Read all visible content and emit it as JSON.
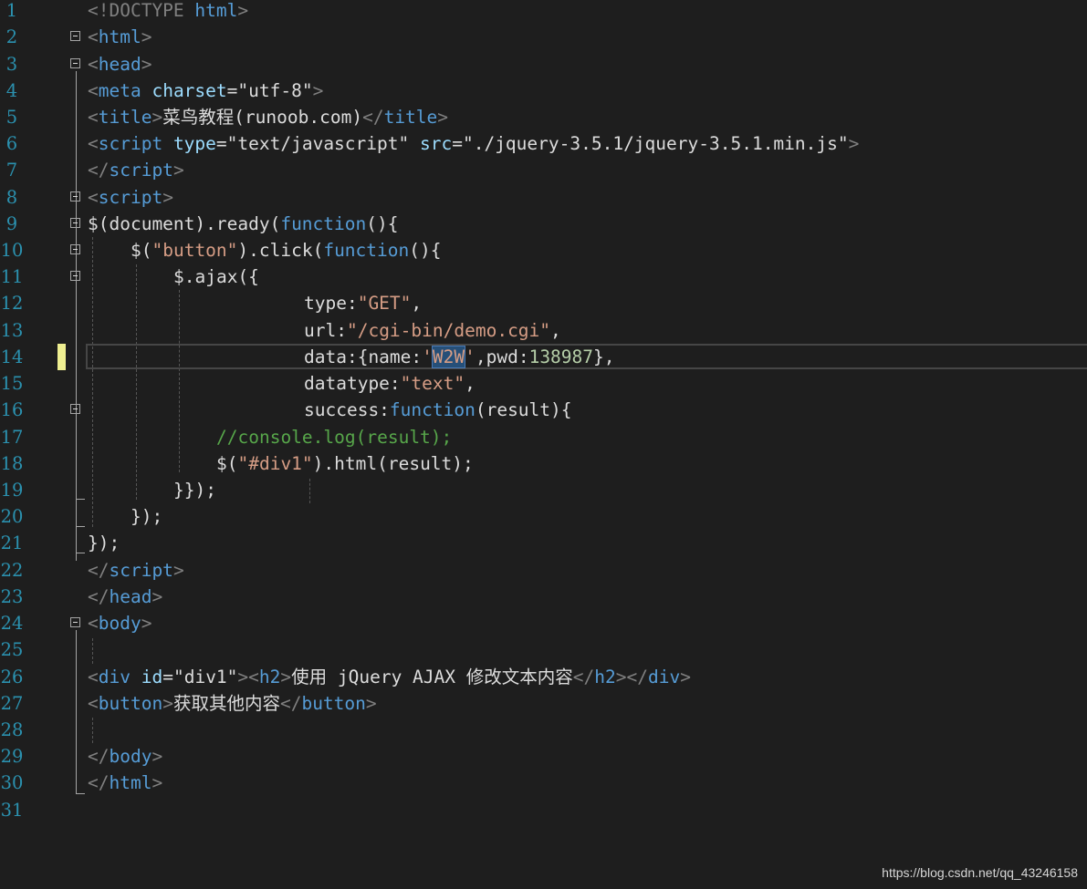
{
  "editor": {
    "line_numbers": [
      "1",
      "2",
      "3",
      "4",
      "5",
      "6",
      "7",
      "8",
      "9",
      "10",
      "11",
      "12",
      "13",
      "14",
      "15",
      "16",
      "17",
      "18",
      "19",
      "20",
      "21",
      "22",
      "23",
      "24",
      "25",
      "26",
      "27",
      "28",
      "29",
      "30",
      "31"
    ],
    "lines": {
      "l1": {
        "t1": "<!DOCTYPE",
        "t2": " html",
        "t3": ">"
      },
      "l2": {
        "t1": "<",
        "t2": "html",
        "t3": ">"
      },
      "l3": {
        "t1": "<",
        "t2": "head",
        "t3": ">"
      },
      "l4": {
        "t1": "<",
        "t2": "meta",
        "t3": " charset",
        "t4": "=",
        "t5": "\"utf-8\"",
        "t6": ">"
      },
      "l5": {
        "t1": "<",
        "t2": "title",
        "t3": ">",
        "t4": "菜鸟教程(runoob.com)",
        "t5": "</",
        "t6": "title",
        "t7": ">"
      },
      "l6": {
        "t1": "<",
        "t2": "script",
        "t3": " type",
        "t4": "=",
        "t5": "\"text/javascript\"",
        "t6": " src",
        "t7": "=",
        "t8": "\"./jquery-3.5.1/jquery-3.5.1.min.js\"",
        "t9": ">"
      },
      "l7": {
        "t1": "</",
        "t2": "script",
        "t3": ">"
      },
      "l8": {
        "t1": "<",
        "t2": "script",
        "t3": ">"
      },
      "l9": {
        "t1": "$(document).ready(",
        "t2": "function",
        "t3": "(){"
      },
      "l10": {
        "t1": "$(",
        "t2": "\"button\"",
        "t3": ").click(",
        "t4": "function",
        "t5": "(){"
      },
      "l11": {
        "t1": "$.ajax({"
      },
      "l12": {
        "t1": "type:",
        "t2": "\"GET\"",
        "t3": ","
      },
      "l13": {
        "t1": "url:",
        "t2": "\"/cgi-bin/demo.cgi\"",
        "t3": ","
      },
      "l14": {
        "t1": "data:{name:",
        "t2": "'",
        "t3": "W2W",
        "t4": "'",
        "t5": ",pwd:",
        "t6": "138987",
        "t7": "},"
      },
      "l15": {
        "t1": "datatype:",
        "t2": "\"text\"",
        "t3": ","
      },
      "l16": {
        "t1": "success:",
        "t2": "function",
        "t3": "(result){"
      },
      "l17": {
        "t1": "//console.log(result);"
      },
      "l18": {
        "t1": "$(",
        "t2": "\"#div1\"",
        "t3": ").html(result);"
      },
      "l19": {
        "t1": "}});"
      },
      "l20": {
        "t1": "});"
      },
      "l21": {
        "t1": "});"
      },
      "l22": {
        "t1": "</",
        "t2": "script",
        "t3": ">"
      },
      "l23": {
        "t1": "</",
        "t2": "head",
        "t3": ">"
      },
      "l24": {
        "t1": "<",
        "t2": "body",
        "t3": ">"
      },
      "l26": {
        "t1": "<",
        "t2": "div",
        "t3": " id",
        "t4": "=",
        "t5": "\"div1\"",
        "t6": "><",
        "t7": "h2",
        "t8": ">",
        "t9": "使用 jQuery AJAX 修改文本内容",
        "t10": "</",
        "t11": "h2",
        "t12": "></",
        "t13": "div",
        "t14": ">"
      },
      "l27": {
        "t1": "<",
        "t2": "button",
        "t3": ">",
        "t4": "获取其他内容",
        "t5": "</",
        "t6": "button",
        "t7": ">"
      },
      "l29": {
        "t1": "</",
        "t2": "body",
        "t3": ">"
      },
      "l30": {
        "t1": "</",
        "t2": "html",
        "t3": ">"
      }
    },
    "colors": {
      "background": "#1e1e1e",
      "line_number": "#2b91af",
      "tag": "#569cd6",
      "attribute": "#9cdcfe",
      "string": "#d69d85",
      "comment": "#57a64a",
      "number": "#b5cea8",
      "selection": "#264f78",
      "change_marker": "#efef91"
    }
  },
  "watermark": "https://blog.csdn.net/qq_43246158"
}
